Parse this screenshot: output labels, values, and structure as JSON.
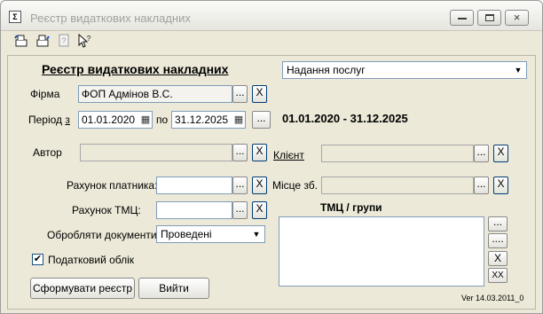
{
  "window": {
    "title": "Реєстр видаткових накладних",
    "buttons": {
      "minimize": "minimize",
      "maximize": "maximize",
      "close": "×"
    }
  },
  "toolbar": {
    "icons": [
      "preview-icon",
      "print-icon",
      "help-icon",
      "whats-this-icon"
    ]
  },
  "form": {
    "header": "Реєстр видаткових накладних",
    "type_select": {
      "value": "Надання послуг"
    },
    "firm": {
      "label": "Фірма",
      "value": "ФОП Адмінов В.С.",
      "browse": "...",
      "clear": "X"
    },
    "period": {
      "label_prefix": "Період",
      "label_suffix": "з",
      "from": "01.01.2020",
      "to_label": "по",
      "to": "31.12.2025",
      "browse": "...",
      "summary": "01.01.2020 - 31.12.2025"
    },
    "author": {
      "label": "Автор",
      "value": "",
      "browse": "...",
      "clear": "X"
    },
    "client": {
      "label": "Клієнт",
      "value": "",
      "browse": "...",
      "clear": "X"
    },
    "payer_account": {
      "label": "Рахунок платника:",
      "value": "",
      "browse": "...",
      "clear": "X"
    },
    "place": {
      "label": "Місце зб.",
      "value": "",
      "browse": "...",
      "clear": "X"
    },
    "tmc_account": {
      "label": "Рахунок ТМЦ:",
      "value": "",
      "browse": "...",
      "clear": "X"
    },
    "process_docs": {
      "label": "Обробляти документи:",
      "value": "Проведені"
    },
    "tax_accounting": {
      "label": "Податковий облік",
      "checked": true,
      "check_mark": "✔"
    },
    "tmc_groups": {
      "label": "ТМЦ / групи",
      "buttons": [
        "...",
        "....",
        "X",
        "XX"
      ]
    },
    "actions": {
      "generate": "Сформувати реєстр",
      "exit": "Вийти"
    },
    "version": "Ver 14.03.2011_0"
  }
}
